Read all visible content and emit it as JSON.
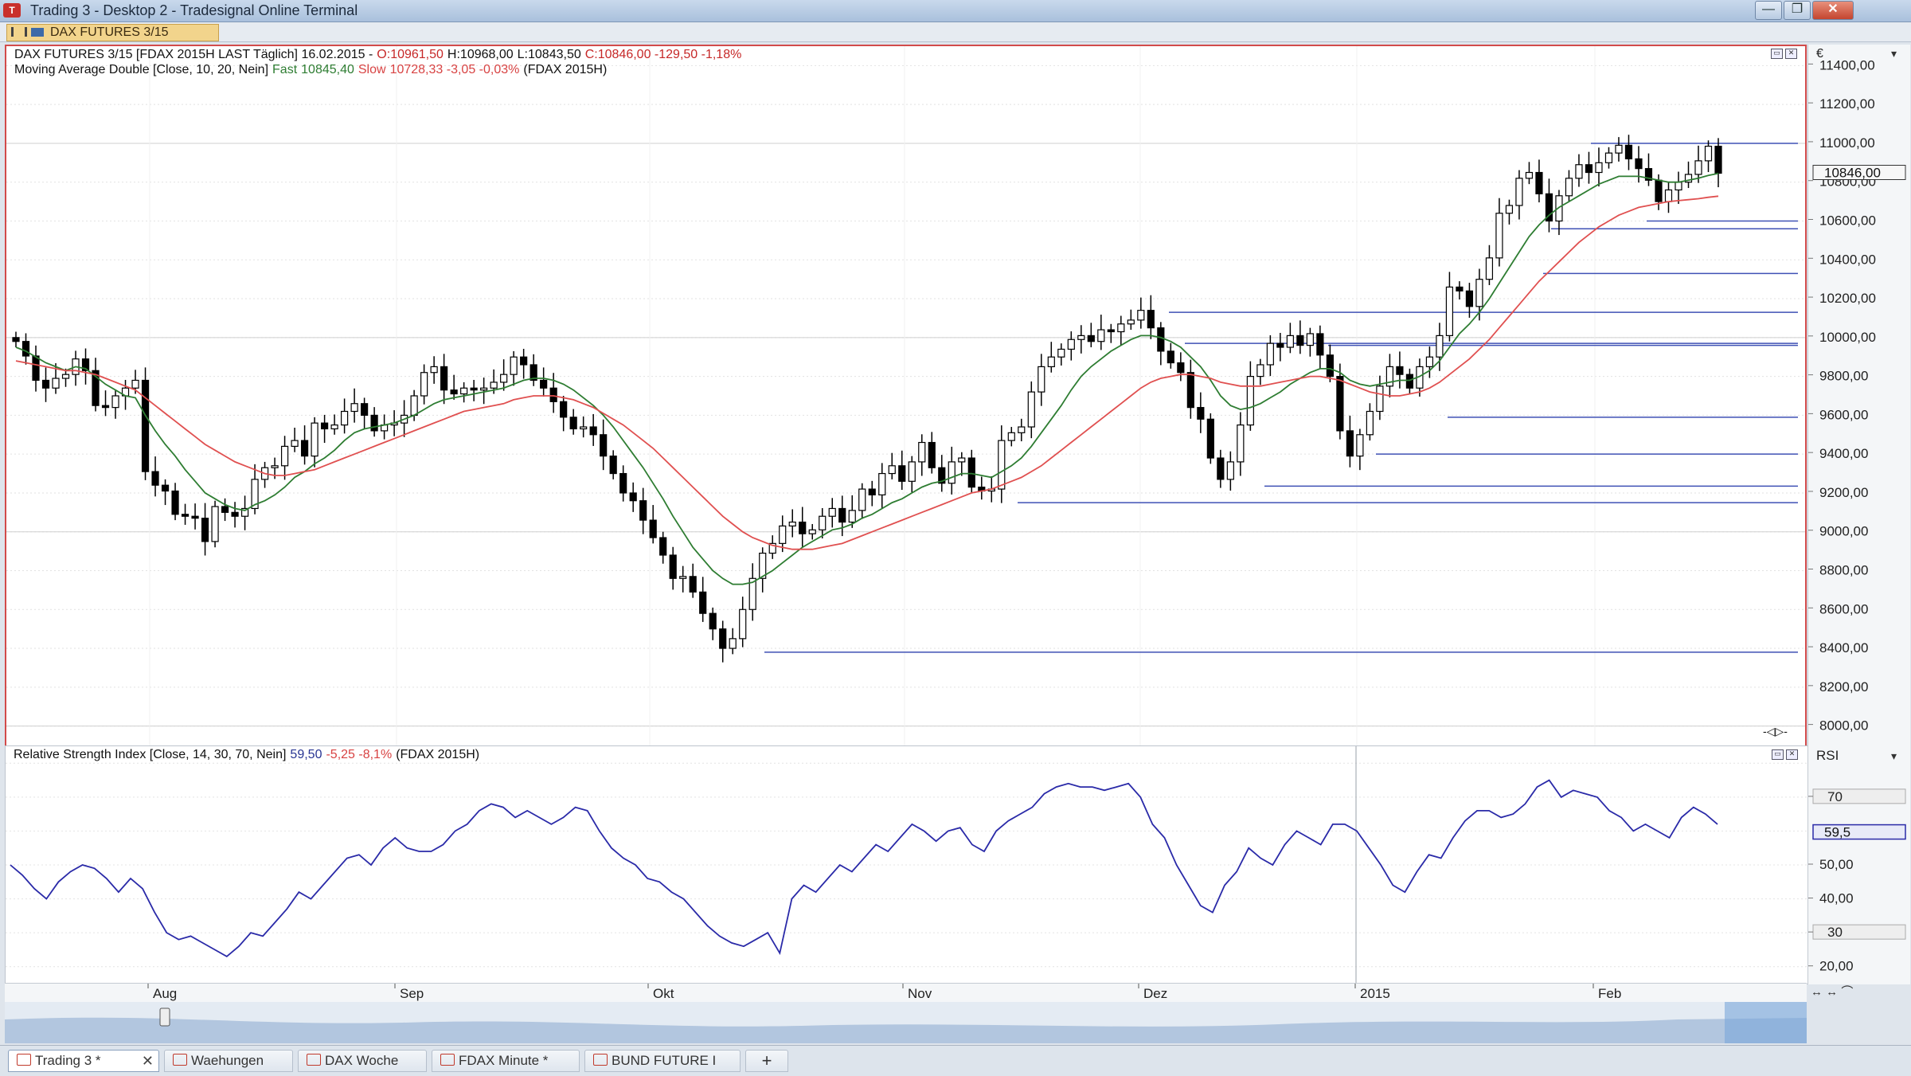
{
  "window": {
    "title": "Trading 3 - Desktop 2 - Tradesignal Online Terminal",
    "minimize": "—",
    "restore": "❐",
    "close": "✕"
  },
  "symbol_tab": {
    "label": "DAX FUTURES 3/15",
    "nav_left": "◁",
    "nav_right": "▷",
    "close": "✕"
  },
  "price_legend": {
    "instrument": "DAX FUTURES 3/15 [FDAX 2015H LAST Täglich] 16.02.2015 -",
    "open": "O:10961,50",
    "high": "H:10968,00",
    "low": "L:10843,50",
    "close": "C:10846,00 -129,50 -1,18%"
  },
  "ma_legend": {
    "name": "Moving Average Double [Close, 10, 20, Nein]",
    "fast_label": "Fast",
    "fast_value": "10845,40",
    "slow_label": "Slow",
    "slow_value": "10728,33 -3,05 -0,03%",
    "source": "(FDAX 2015H)"
  },
  "rsi_legend": {
    "name": "Relative Strength Index [Close, 14, 30, 70, Nein]",
    "value": "59,50",
    "change": "-5,25 -8,1%",
    "source": "(FDAX 2015H)"
  },
  "price_axis": {
    "currency": "€",
    "labels": [
      "11400,00",
      "11200,00",
      "11000,00",
      "10800,00",
      "10600,00",
      "10400,00",
      "10200,00",
      "10000,00",
      "9800,00",
      "9600,00",
      "9400,00",
      "9200,00",
      "9000,00",
      "8800,00",
      "8600,00",
      "8400,00",
      "8200,00",
      "8000,00"
    ],
    "current_price": "10846,00",
    "scroll_marker": "-◁▷-"
  },
  "rsi_axis": {
    "title": "RSI",
    "labels": [
      "70",
      "50,00",
      "40,00",
      "30",
      "20,00"
    ],
    "current": "59,5"
  },
  "time_axis": {
    "labels": [
      "Aug",
      "Sep",
      "Okt",
      "Nov",
      "Dez",
      "2015",
      "Feb"
    ],
    "controls": "↔ ↔ ⌒"
  },
  "tabs": [
    "Trading 3 *",
    "Waehungen",
    "DAX Woche",
    "FDAX Minute *",
    "BUND FUTURE I"
  ],
  "tab_close": "✕",
  "add_tab": "+",
  "chart_data": {
    "type": "candlestick",
    "instrument": "DAX FUTURES 3/15",
    "ylim": [
      7900,
      11500
    ],
    "x_labels": [
      "Aug",
      "Sep",
      "Okt",
      "Nov",
      "Dez",
      "2015",
      "Feb"
    ],
    "close": [
      9980,
      9905,
      9780,
      9740,
      9790,
      9810,
      9890,
      9830,
      9650,
      9640,
      9700,
      9740,
      9780,
      9310,
      9240,
      9210,
      9090,
      9080,
      9070,
      8950,
      9130,
      9100,
      9080,
      9120,
      9270,
      9330,
      9340,
      9440,
      9470,
      9390,
      9560,
      9530,
      9550,
      9620,
      9660,
      9600,
      9520,
      9550,
      9560,
      9600,
      9700,
      9820,
      9850,
      9730,
      9710,
      9740,
      9730,
      9740,
      9770,
      9810,
      9900,
      9860,
      9780,
      9740,
      9670,
      9590,
      9530,
      9540,
      9500,
      9390,
      9300,
      9200,
      9160,
      9060,
      8970,
      8880,
      8760,
      8770,
      8690,
      8580,
      8500,
      8400,
      8450,
      8600,
      8760,
      8890,
      8940,
      9030,
      9050,
      8990,
      9010,
      9080,
      9120,
      9050,
      9110,
      9220,
      9190,
      9300,
      9340,
      9260,
      9360,
      9460,
      9330,
      9250,
      9360,
      9380,
      9230,
      9210,
      9220,
      9470,
      9510,
      9540,
      9720,
      9850,
      9900,
      9940,
      9990,
      10010,
      9980,
      10040,
      10030,
      10070,
      10090,
      10140,
      10050,
      9930,
      9870,
      9820,
      9640,
      9580,
      9380,
      9270,
      9360,
      9550,
      9800,
      9860,
      9970,
      9950,
      10010,
      9960,
      10020,
      9910,
      9800,
      9520,
      9390,
      9500,
      9620,
      9750,
      9850,
      9810,
      9740,
      9850,
      9900,
      10010,
      10260,
      10240,
      10160,
      10300,
      10410,
      10640,
      10680,
      10820,
      10850,
      10740,
      10600,
      10730,
      10820,
      10890,
      10850,
      10900,
      10950,
      10990,
      10920,
      10870,
      10810,
      10700,
      10760,
      10800,
      10840,
      10910,
      10985,
      10846
    ],
    "series": [
      {
        "name": "Fast",
        "values": [
          9950,
          9930,
          9900,
          9870,
          9850,
          9830,
          9850,
          9840,
          9800,
          9760,
          9730,
          9700,
          9690,
          9600,
          9520,
          9450,
          9390,
          9320,
          9260,
          9200,
          9170,
          9140,
          9120,
          9110,
          9140,
          9160,
          9190,
          9230,
          9280,
          9310,
          9350,
          9380,
          9420,
          9470,
          9510,
          9530,
          9540,
          9550,
          9560,
          9580,
          9600,
          9630,
          9660,
          9680,
          9690,
          9700,
          9710,
          9720,
          9730,
          9740,
          9760,
          9780,
          9790,
          9790,
          9780,
          9760,
          9730,
          9690,
          9650,
          9600,
          9540,
          9470,
          9400,
          9330,
          9250,
          9170,
          9080,
          9000,
          8920,
          8860,
          8800,
          8760,
          8730,
          8730,
          8740,
          8770,
          8800,
          8840,
          8880,
          8920,
          8950,
          8980,
          9010,
          9020,
          9040,
          9070,
          9090,
          9120,
          9150,
          9170,
          9200,
          9230,
          9250,
          9260,
          9280,
          9300,
          9300,
          9290,
          9280,
          9310,
          9340,
          9380,
          9440,
          9510,
          9580,
          9650,
          9730,
          9800,
          9850,
          9890,
          9930,
          9960,
          9990,
          10010,
          10010,
          10000,
          9980,
          9950,
          9900,
          9850,
          9780,
          9700,
          9650,
          9630,
          9640,
          9660,
          9690,
          9720,
          9760,
          9790,
          9820,
          9840,
          9840,
          9820,
          9780,
          9760,
          9750,
          9760,
          9770,
          9780,
          9780,
          9800,
          9830,
          9880,
          9950,
          10020,
          10070,
          10130,
          10200,
          10280,
          10360,
          10440,
          10520,
          10580,
          10630,
          10670,
          10700,
          10730,
          10760,
          10790,
          10810,
          10830,
          10830,
          10830,
          10820,
          10810,
          10800,
          10800,
          10810,
          10820,
          10835,
          10845
        ]
      },
      {
        "name": "Slow",
        "values": [
          9880,
          9870,
          9860,
          9850,
          9840,
          9830,
          9830,
          9820,
          9810,
          9790,
          9770,
          9750,
          9730,
          9690,
          9650,
          9610,
          9570,
          9530,
          9490,
          9450,
          9420,
          9390,
          9360,
          9340,
          9320,
          9300,
          9290,
          9290,
          9300,
          9310,
          9320,
          9340,
          9360,
          9380,
          9400,
          9420,
          9440,
          9460,
          9480,
          9500,
          9520,
          9540,
          9560,
          9580,
          9600,
          9620,
          9630,
          9640,
          9650,
          9660,
          9680,
          9690,
          9700,
          9700,
          9700,
          9690,
          9680,
          9660,
          9640,
          9610,
          9580,
          9550,
          9510,
          9470,
          9430,
          9380,
          9330,
          9280,
          9230,
          9180,
          9130,
          9080,
          9040,
          9000,
          8970,
          8950,
          8930,
          8920,
          8910,
          8910,
          8910,
          8920,
          8930,
          8940,
          8960,
          8980,
          9000,
          9020,
          9040,
          9060,
          9080,
          9100,
          9120,
          9140,
          9160,
          9180,
          9200,
          9210,
          9220,
          9240,
          9260,
          9280,
          9310,
          9340,
          9380,
          9420,
          9460,
          9500,
          9540,
          9580,
          9620,
          9660,
          9700,
          9740,
          9770,
          9790,
          9800,
          9810,
          9810,
          9800,
          9790,
          9770,
          9760,
          9750,
          9750,
          9750,
          9760,
          9770,
          9780,
          9790,
          9800,
          9800,
          9790,
          9780,
          9760,
          9740,
          9720,
          9710,
          9700,
          9700,
          9710,
          9720,
          9740,
          9770,
          9810,
          9850,
          9890,
          9940,
          9990,
          10050,
          10110,
          10170,
          10230,
          10290,
          10340,
          10390,
          10440,
          10490,
          10530,
          10570,
          10600,
          10630,
          10650,
          10670,
          10680,
          10690,
          10700,
          10705,
          10710,
          10715,
          10722,
          10728
        ]
      }
    ],
    "rsi": {
      "ylim": [
        15,
        85
      ],
      "values": [
        50,
        47,
        43,
        40,
        45,
        48,
        50,
        49,
        46,
        42,
        46,
        43,
        36,
        30,
        28,
        29,
        27,
        25,
        23,
        26,
        30,
        29,
        33,
        37,
        42,
        40,
        44,
        48,
        52,
        53,
        50,
        55,
        58,
        55,
        54,
        54,
        56,
        60,
        62,
        66,
        68,
        67,
        64,
        66,
        64,
        62,
        64,
        67,
        66,
        60,
        55,
        52,
        50,
        46,
        45,
        42,
        40,
        36,
        32,
        29,
        27,
        26,
        28,
        30,
        24,
        40,
        44,
        42,
        46,
        50,
        48,
        52,
        56,
        54,
        58,
        62,
        60,
        57,
        60,
        61,
        56,
        54,
        60,
        63,
        65,
        67,
        71,
        73,
        74,
        73,
        73,
        72,
        73,
        74,
        70,
        62,
        58,
        50,
        44,
        38,
        36,
        44,
        48,
        55,
        52,
        50,
        56,
        60,
        58,
        56,
        62,
        62,
        60,
        55,
        50,
        44,
        42,
        48,
        53,
        52,
        58,
        63,
        66,
        66,
        64,
        65,
        68,
        73,
        75,
        70,
        72,
        71,
        70,
        66,
        64,
        60,
        62,
        60,
        58,
        64,
        67,
        65,
        62
      ],
      "levels": [
        30,
        70
      ]
    },
    "horizontal_lines": [
      11000,
      10600,
      10560,
      10330,
      10130,
      9970,
      9960,
      9590,
      9400,
      9235,
      9150,
      8380
    ]
  }
}
